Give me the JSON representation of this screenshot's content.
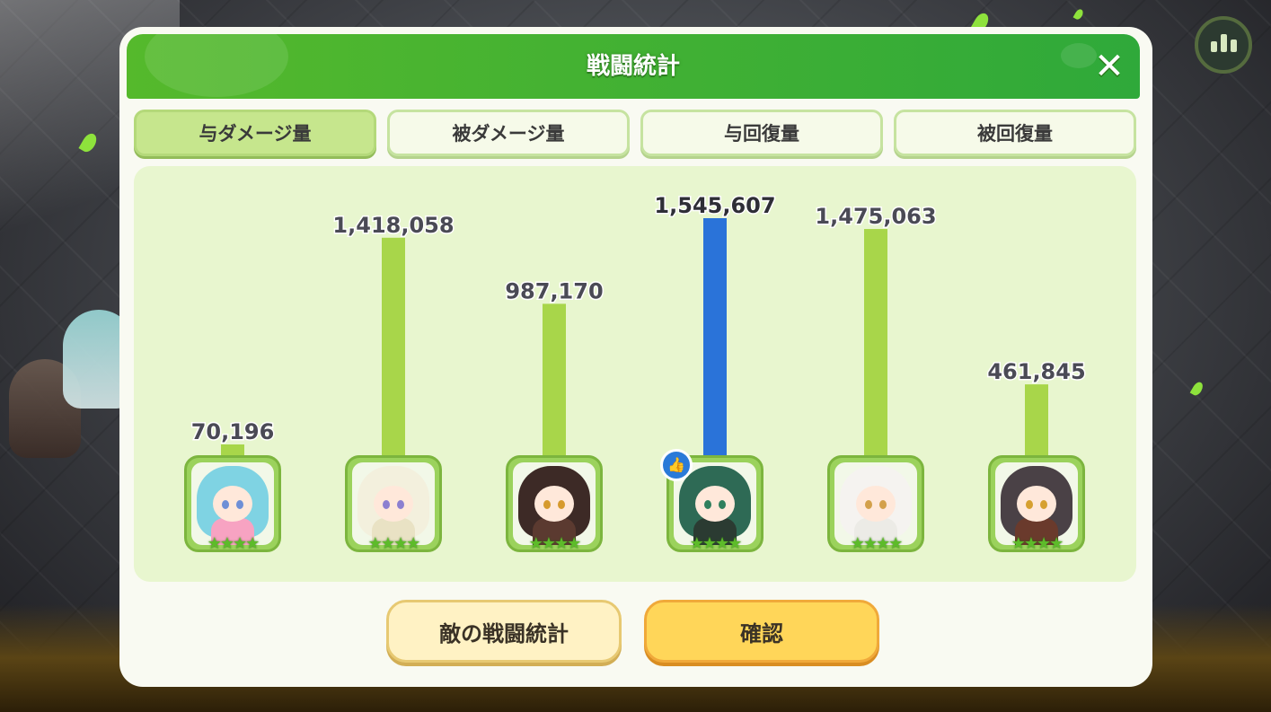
{
  "dialog": {
    "title": "戦闘統計",
    "close_label": "✕"
  },
  "tabs": [
    {
      "label": "与ダメージ量",
      "active": true
    },
    {
      "label": "被ダメージ量",
      "active": false
    },
    {
      "label": "与回復量",
      "active": false
    },
    {
      "label": "被回復量",
      "active": false
    }
  ],
  "chart_data": {
    "type": "bar",
    "categories": [
      "char-1",
      "char-2",
      "char-3",
      "char-4",
      "char-5",
      "char-6"
    ],
    "values": [
      70196,
      1418058,
      987170,
      1545607,
      1475063,
      461845
    ],
    "labels": [
      "70,196",
      "1,418,058",
      "987,170",
      "1,545,607",
      "1,475,063",
      "461,845"
    ],
    "ylim": [
      0,
      1545607
    ],
    "highlight_index": 3,
    "colors": {
      "bar": "#a8d64a",
      "highlight": "#2a73d9",
      "label": "#4a4a55"
    }
  },
  "characters": [
    {
      "hair": "#7fd3e3",
      "eye": "#6e8fd6",
      "outfit": "#f7a3c2",
      "stars": "★★★★"
    },
    {
      "hair": "#f3f0dd",
      "eye": "#8c7fd0",
      "outfit": "#e9e2c4",
      "stars": "★★★★"
    },
    {
      "hair": "#3d2a26",
      "eye": "#d69a2d",
      "outfit": "#5b3a30",
      "stars": "★★★★"
    },
    {
      "hair": "#2e6a55",
      "eye": "#2f7f5d",
      "outfit": "#2b3b32",
      "stars": "★★★★",
      "mvp": true
    },
    {
      "hair": "#f5f3f0",
      "eye": "#d3a04a",
      "outfit": "#ecebe6",
      "stars": "★★★★"
    },
    {
      "hair": "#4a4146",
      "eye": "#d6a030",
      "outfit": "#6a3a2c",
      "stars": "★★★★"
    }
  ],
  "buttons": {
    "enemy_stats": "敵の戦闘統計",
    "confirm": "確認"
  }
}
